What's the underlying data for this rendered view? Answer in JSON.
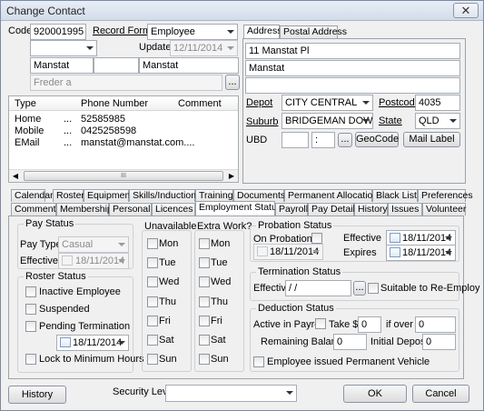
{
  "window": {
    "title": "Change Contact",
    "close_glyph": "✕"
  },
  "header": {
    "code_label": "Code",
    "code_value": "920001995",
    "record_format_label": "Record Format",
    "record_format_value": "Employee",
    "updated_label": "Updated",
    "updated_value": "12/11/2014",
    "name_first": "Manstat",
    "name_last": "Manstat",
    "display_name": "Freder a",
    "ellipsis": "..."
  },
  "contacts_table": {
    "headers": [
      "Type",
      "Phone Number",
      "Comment"
    ],
    "rows": [
      {
        "type": "Home",
        "dots": "...",
        "number": "52585985"
      },
      {
        "type": "Mobile",
        "dots": "...",
        "number": "0425258598"
      },
      {
        "type": "EMail",
        "dots": "...",
        "number": "manstat@manstat.com...."
      }
    ],
    "scroll_grip": "III"
  },
  "address": {
    "tabs": [
      "Address",
      "Postal Address"
    ],
    "line1": "11 Manstat Pl",
    "line2": "Manstat",
    "depot_label": "Depot",
    "depot_value": "CITY CENTRAL",
    "postcode_label": "Postcode",
    "postcode_value": "4035",
    "suburb_label": "Suburb",
    "suburb_value": "BRIDGEMAN DOWNS",
    "state_label": "State",
    "state_value": "QLD",
    "ubd_label": "UBD",
    "ubd_sep": ":",
    "ellipsis": "...",
    "geocode_label": "GeoCode",
    "mail_label_label": "Mail Label"
  },
  "tabs_row1": [
    "Calendar",
    "Roster",
    "Equipment",
    "Skills/Inductions",
    "Training",
    "Documents",
    "Permanent Allocations",
    "Black List",
    "Preferences"
  ],
  "tabs_row2": [
    "Comments",
    "Memberships",
    "Personal",
    "Licences",
    "Employment Status",
    "Payroll",
    "Pay Details",
    "History",
    "Issues",
    "Volunteer"
  ],
  "pay_status": {
    "caption": "Pay Status",
    "pay_type_label": "Pay Type",
    "pay_type_value": "Casual",
    "effective_label": "Effective",
    "effective_value": "18/11/2014"
  },
  "roster_status": {
    "caption": "Roster Status",
    "inactive": "Inactive Employee",
    "suspended": "Suspended",
    "pending": "Pending Termination",
    "pending_date": "18/11/2014",
    "lock": "Lock to Minimum Hours"
  },
  "unavailable": {
    "caption": "Unavailable",
    "days": [
      "Mon",
      "Tue",
      "Wed",
      "Thu",
      "Fri",
      "Sat",
      "Sun"
    ]
  },
  "extra_work": {
    "caption": "Extra Work?",
    "days": [
      "Mon",
      "Tue",
      "Wed",
      "Thu",
      "Fri",
      "Sat",
      "Sun"
    ]
  },
  "probation": {
    "caption": "Probation Status",
    "on_probation": "On Probation",
    "start_date": "18/11/2014",
    "effective_label": "Effective",
    "effective_value": "18/11/2014",
    "expires_label": "Expires",
    "expires_value": "18/11/2014"
  },
  "termination": {
    "caption": "Termination Status",
    "effective_label": "Effective",
    "effective_value": " / /",
    "ellipsis": "...",
    "suitable": "Suitable to Re-Employ"
  },
  "deduction": {
    "caption": "Deduction Status",
    "active_label": "Active in Payroll",
    "take_label": "Take $",
    "take_value": "0",
    "if_over_label": "if over",
    "if_over_value": "0",
    "remaining_label": "Remaining Balance",
    "remaining_value": "0",
    "initial_label": "Initial Deposit",
    "initial_value": "0",
    "permanent_vehicle": "Employee issued Permanent Vehicle"
  },
  "footer": {
    "history_label": "History",
    "security_label": "Security Level",
    "ok_label": "OK",
    "cancel_label": "Cancel"
  }
}
